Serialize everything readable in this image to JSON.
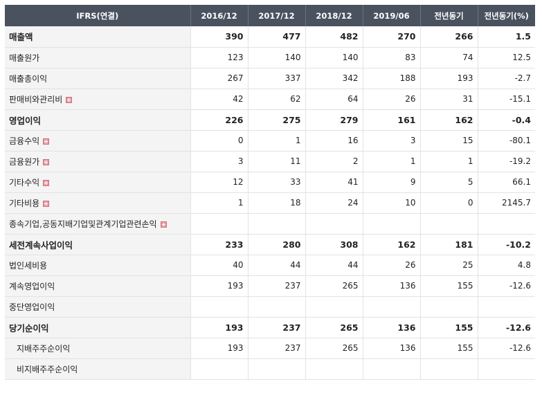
{
  "header": {
    "label": "IFRS(연결)",
    "columns": [
      "2016/12",
      "2017/12",
      "2018/12",
      "2019/06",
      "전년동기",
      "전년동기(%)"
    ]
  },
  "rows": [
    {
      "label": "매출액",
      "bold": true,
      "expand": false,
      "sub": false,
      "values": [
        "390",
        "477",
        "482",
        "270",
        "266",
        "1.5"
      ]
    },
    {
      "label": "매출원가",
      "bold": false,
      "expand": false,
      "sub": false,
      "values": [
        "123",
        "140",
        "140",
        "83",
        "74",
        "12.5"
      ]
    },
    {
      "label": "매출총이익",
      "bold": false,
      "expand": false,
      "sub": false,
      "values": [
        "267",
        "337",
        "342",
        "188",
        "193",
        "-2.7"
      ]
    },
    {
      "label": "판매비와관리비",
      "bold": false,
      "expand": true,
      "sub": false,
      "values": [
        "42",
        "62",
        "64",
        "26",
        "31",
        "-15.1"
      ]
    },
    {
      "label": "영업이익",
      "bold": true,
      "expand": false,
      "sub": false,
      "values": [
        "226",
        "275",
        "279",
        "161",
        "162",
        "-0.4"
      ]
    },
    {
      "label": "금융수익",
      "bold": false,
      "expand": true,
      "sub": false,
      "values": [
        "0",
        "1",
        "16",
        "3",
        "15",
        "-80.1"
      ]
    },
    {
      "label": "금융원가",
      "bold": false,
      "expand": true,
      "sub": false,
      "values": [
        "3",
        "11",
        "2",
        "1",
        "1",
        "-19.2"
      ]
    },
    {
      "label": "기타수익",
      "bold": false,
      "expand": true,
      "sub": false,
      "values": [
        "12",
        "33",
        "41",
        "9",
        "5",
        "66.1"
      ]
    },
    {
      "label": "기타비용",
      "bold": false,
      "expand": true,
      "sub": false,
      "values": [
        "1",
        "18",
        "24",
        "10",
        "0",
        "2145.7"
      ]
    },
    {
      "label": "종속기업,공동지배기업및관계기업관련손익",
      "bold": false,
      "expand": true,
      "sub": false,
      "values": [
        "",
        "",
        "",
        "",
        "",
        ""
      ]
    },
    {
      "label": "세전계속사업이익",
      "bold": true,
      "expand": false,
      "sub": false,
      "values": [
        "233",
        "280",
        "308",
        "162",
        "181",
        "-10.2"
      ]
    },
    {
      "label": "법인세비용",
      "bold": false,
      "expand": false,
      "sub": false,
      "values": [
        "40",
        "44",
        "44",
        "26",
        "25",
        "4.8"
      ]
    },
    {
      "label": "계속영업이익",
      "bold": false,
      "expand": false,
      "sub": false,
      "values": [
        "193",
        "237",
        "265",
        "136",
        "155",
        "-12.6"
      ]
    },
    {
      "label": "중단영업이익",
      "bold": false,
      "expand": false,
      "sub": false,
      "values": [
        "",
        "",
        "",
        "",
        "",
        ""
      ]
    },
    {
      "label": "당기순이익",
      "bold": true,
      "expand": false,
      "sub": false,
      "values": [
        "193",
        "237",
        "265",
        "136",
        "155",
        "-12.6"
      ]
    },
    {
      "label": "지배주주순이익",
      "bold": false,
      "expand": false,
      "sub": true,
      "values": [
        "193",
        "237",
        "265",
        "136",
        "155",
        "-12.6"
      ]
    },
    {
      "label": "비지배주주순이익",
      "bold": false,
      "expand": false,
      "sub": true,
      "values": [
        "",
        "",
        "",
        "",
        "",
        ""
      ]
    }
  ],
  "colors": {
    "header_bg": "#4a5260",
    "negative": "#d40000",
    "label_bg": "#f4f4f4"
  }
}
